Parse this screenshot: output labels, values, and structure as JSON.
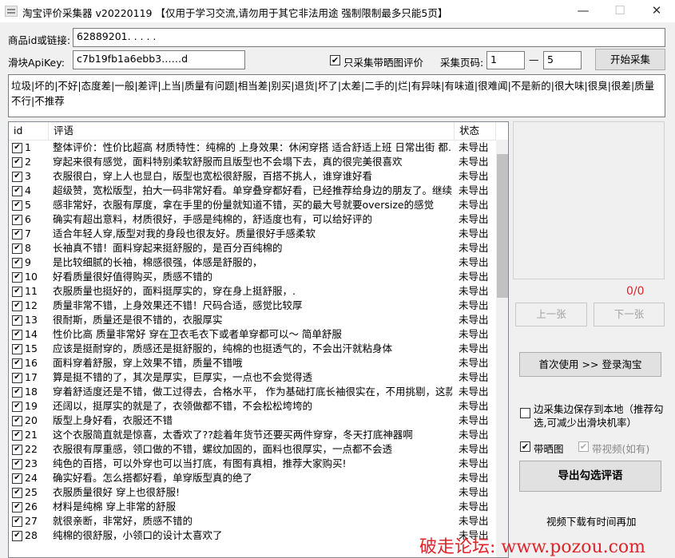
{
  "window": {
    "title": "淘宝评价采集器 v20220119 【仅用于学习交流,请勿用于其它非法用途 强制限制最多只能5页】",
    "minimize_icon": "minimize-icon",
    "maximize_icon": "maximize-icon",
    "close_icon": "close-icon"
  },
  "form": {
    "item_label": "商品id或链接:",
    "item_value": "62889201. . . . .",
    "apikey_label": "滑块ApiKey:",
    "apikey_value": "c7b19fb1a6ebb3……d",
    "only_image_label": "只采集带晒图评价",
    "only_image_checked": true,
    "pages_label": "采集页码:",
    "page_from": "1",
    "page_sep": "—",
    "page_to": "5",
    "start_button": "开始采集"
  },
  "filter_words": "垃圾|坏的|不好|态度差|一般|差评|上当|质量有问题|相当差|别买|退货|坏了|太差|二手的|烂|有异味|有味道|很难闻|不是新的|很大味|很臭|很差|质量不行|不推荐",
  "table": {
    "headers": [
      "id",
      "评语",
      "状态"
    ],
    "rows": [
      {
        "id": "1",
        "comment": "整体评价：性价比超高 材质特性：纯棉的 上身效果：休闲穿搭 适合舒适上班 日常出街 都…",
        "status": "未导出"
      },
      {
        "id": "2",
        "comment": "穿起来很有感觉，面料特别柔软舒服而且版型也不会塌下去，真的很完美很喜欢",
        "status": "未导出"
      },
      {
        "id": "3",
        "comment": "衣服很白，穿上人也显白，版型也宽松很舒服，百搭不挑人，谁穿谁好看",
        "status": "未导出"
      },
      {
        "id": "4",
        "comment": "超级赞，宽松版型，拍大一码非常好看。单穿叠穿都好看，已经推荐给身边的朋友了。继续…",
        "status": "未导出"
      },
      {
        "id": "5",
        "comment": "感非常好，衣服有厚度，拿在手里的份量就知道不错，买的最大号就要oversize的感觉",
        "status": "未导出"
      },
      {
        "id": "6",
        "comment": "确实有超出意料，材质很好，手感是纯棉的，舒适度也有，可以给好评的",
        "status": "未导出"
      },
      {
        "id": "7",
        "comment": "适合年轻人穿,版型对我的身段也很友好。质量很好手感柔软",
        "status": "未导出"
      },
      {
        "id": "8",
        "comment": "长袖真不错！面料穿起来挺舒服的，是百分百纯棉的",
        "status": "未导出"
      },
      {
        "id": "9",
        "comment": "是比较细腻的长袖，棉感很强，体感是舒服的，",
        "status": "未导出"
      },
      {
        "id": "10",
        "comment": "好看质量很好值得购买，质感不错的",
        "status": "未导出"
      },
      {
        "id": "11",
        "comment": "衣服质量也挺好的，面料挺厚实的，穿在身上挺舒服，.",
        "status": "未导出"
      },
      {
        "id": "12",
        "comment": "质量非常不错，上身效果还不错！尺码合适，感觉比较厚",
        "status": "未导出"
      },
      {
        "id": "13",
        "comment": "很耐斯，质量还是很不错的，衣服厚实",
        "status": "未导出"
      },
      {
        "id": "14",
        "comment": "性价比高 质量非常好 穿在卫衣毛衣下或者单穿都可以～ 简单舒服",
        "status": "未导出"
      },
      {
        "id": "15",
        "comment": "应该是挺耐穿的，质感还是挺舒服的，纯棉的也挺透气的，不会出汗就粘身体",
        "status": "未导出"
      },
      {
        "id": "16",
        "comment": "面料穿着舒服，穿上效果不错，质量不错哦",
        "status": "未导出"
      },
      {
        "id": "17",
        "comment": "算是挺不错的了，其次是厚实，巨厚实，一点也不会觉得透",
        "status": "未导出"
      },
      {
        "id": "18",
        "comment": "穿着舒适度还是不错，做工过得去，合格水平， 作为基础打底长袖很实在，不用挑剔，这款…",
        "status": "未导出"
      },
      {
        "id": "19",
        "comment": "还阔以，挺厚实的就是了，衣领做都不错，不会松松垮垮的",
        "status": "未导出"
      },
      {
        "id": "20",
        "comment": "版型上身好看，衣服还不错",
        "status": "未导出"
      },
      {
        "id": "21",
        "comment": "这个衣服简直就是惊喜，太香欢了??趁着年货节还要买两件穿穿，冬天打底神器啊",
        "status": "未导出"
      },
      {
        "id": "22",
        "comment": "衣服很有厚重感，领口做的不错，螺纹加固的，面料也很厚实，一点都不会透",
        "status": "未导出"
      },
      {
        "id": "23",
        "comment": "纯色的百搭，可以外穿也可以当打底，有图有真相，推荐大家购买!",
        "status": "未导出"
      },
      {
        "id": "24",
        "comment": "确实好看。怎么搭都好看，单穿版型真的绝了",
        "status": "未导出"
      },
      {
        "id": "25",
        "comment": "衣服质量很好 穿上也很舒服!",
        "status": "未导出"
      },
      {
        "id": "26",
        "comment": "材料是纯棉 穿上非常的舒服",
        "status": "未导出"
      },
      {
        "id": "27",
        "comment": "就很亲断，非常好，质感不错的",
        "status": "未导出"
      },
      {
        "id": "28",
        "comment": "纯棉的很舒服，小领口的设计太喜欢了",
        "status": "未导出"
      }
    ]
  },
  "side": {
    "counter": "0/0",
    "prev_button": "上一张",
    "next_button": "下一张",
    "login_button": "首次使用 >> 登录淘宝",
    "save_local_label": "边采集边保存到本地（推荐勾选,可减少出滑块机率）",
    "save_local_checked": false,
    "with_image_label": "带晒图",
    "with_image_checked": true,
    "with_video_label": "带视频(如有)",
    "with_video_checked": true,
    "export_button": "导出勾选评语",
    "video_note": "视频下载有时间再加"
  },
  "watermark": "破走论坛: www.pozou.com",
  "colors": {
    "counter": "#e0242c",
    "watermark": "#e0242c"
  }
}
